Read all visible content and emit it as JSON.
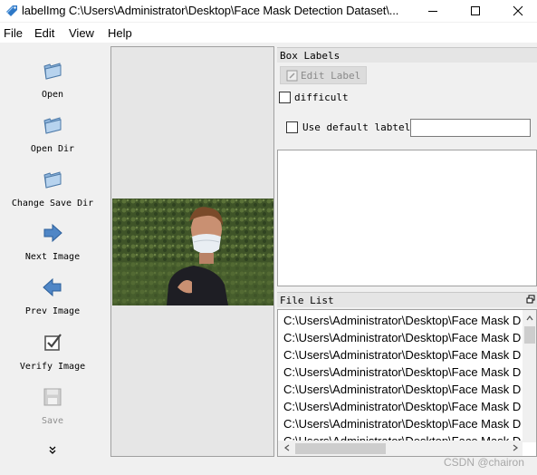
{
  "window": {
    "title": "labelImg C:\\Users\\Administrator\\Desktop\\Face Mask Detection Dataset\\...",
    "icon": "labelimg-tag-icon",
    "controls": [
      "minimize-icon",
      "maximize-icon",
      "close-icon"
    ]
  },
  "menu": [
    "File",
    "Edit",
    "View",
    "Help"
  ],
  "toolbar": {
    "items": [
      {
        "label": "Open",
        "icon": "folder-open-icon",
        "enabled": true
      },
      {
        "label": "Open Dir",
        "icon": "folder-open-icon",
        "enabled": true
      },
      {
        "label": "Change Save Dir",
        "icon": "folder-open-icon",
        "enabled": true
      },
      {
        "label": "Next Image",
        "icon": "arrow-right-icon",
        "enabled": true
      },
      {
        "label": "Prev Image",
        "icon": "arrow-left-icon",
        "enabled": true
      },
      {
        "label": "Verify Image",
        "icon": "checkbox-verify-icon",
        "enabled": true
      },
      {
        "label": "Save",
        "icon": "floppy-disk-icon",
        "enabled": false
      }
    ],
    "more": "chevron-down-double-icon"
  },
  "box_labels": {
    "title": "Box Labels",
    "edit_label": "Edit Label",
    "difficult": "difficult",
    "difficult_checked": false,
    "use_default_label": "Use default labtel",
    "use_default_checked": false,
    "default_label_value": ""
  },
  "file_list": {
    "title": "File List",
    "items": [
      "C:\\Users\\Administrator\\Desktop\\Face Mask D",
      "C:\\Users\\Administrator\\Desktop\\Face Mask D",
      "C:\\Users\\Administrator\\Desktop\\Face Mask D",
      "C:\\Users\\Administrator\\Desktop\\Face Mask D",
      "C:\\Users\\Administrator\\Desktop\\Face Mask D",
      "C:\\Users\\Administrator\\Desktop\\Face Mask D",
      "C:\\Users\\Administrator\\Desktop\\Face Mask D",
      "C:\\Users\\Administrator\\Desktop\\Face Mask D"
    ]
  },
  "watermark": "CSDN @chairon"
}
